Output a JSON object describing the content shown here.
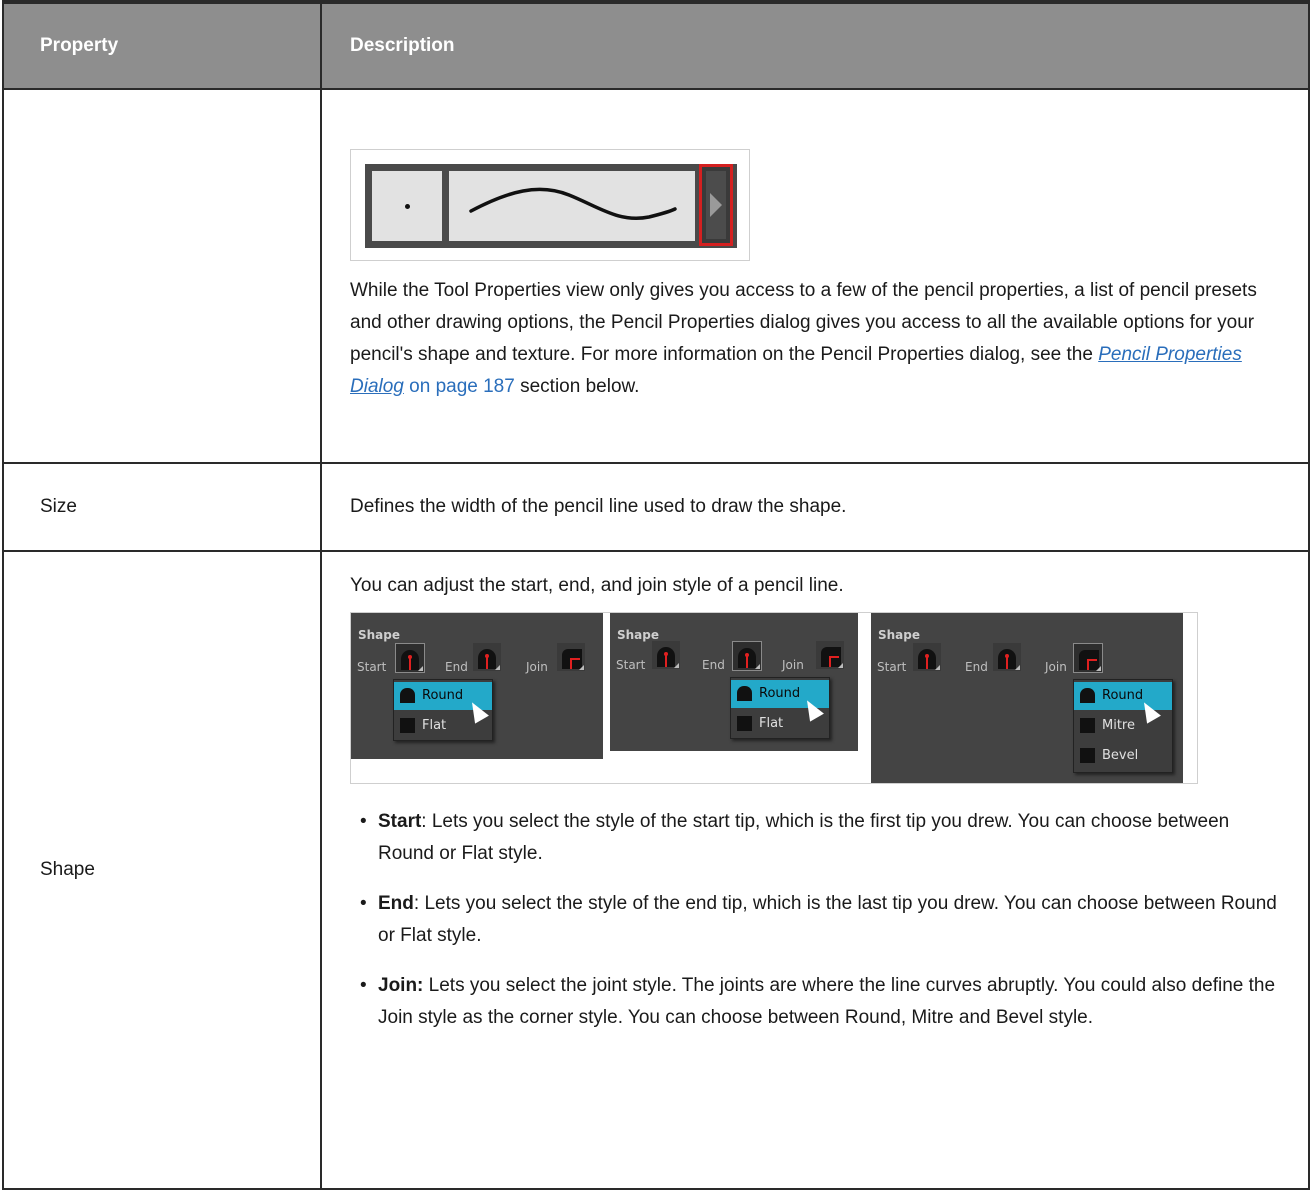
{
  "header": {
    "col1": "Property",
    "col2": "Description"
  },
  "row1": {
    "property": "",
    "para_before": "While the Tool Properties view only gives you access to a few of the pencil properties, a list of pencil presets and other drawing options, the Pencil Properties dialog gives you access to all the available options for your pencil's shape and texture. For more information on the Pencil Properties dialog, see the ",
    "link_text": "Pencil Properties Dialog",
    "page_ref": " on page 187",
    "para_after": " section below."
  },
  "row2": {
    "property": "Size",
    "description": "Defines the width of the pencil line used to draw the shape."
  },
  "row3": {
    "property": "Shape",
    "intro": "You can adjust the start, end, and join style of a pencil line.",
    "panels": [
      {
        "title": "Shape",
        "start": "Start",
        "end": "End",
        "join": "Join",
        "menu": [
          "Round",
          "Flat"
        ]
      },
      {
        "title": "Shape",
        "start": "Start",
        "end": "End",
        "join": "Join",
        "menu": [
          "Round",
          "Flat"
        ]
      },
      {
        "title": "Shape",
        "start": "Start",
        "end": "End",
        "join": "Join",
        "menu": [
          "Round",
          "Mitre",
          "Bevel"
        ]
      }
    ],
    "bullets": [
      {
        "term": "Start",
        "text": ": Lets you select the style of the start tip, which is the first tip you drew. You can choose between Round or Flat style."
      },
      {
        "term": "End",
        "text": ": Lets you select the style of the end tip, which is the last tip you drew. You can choose between Round or Flat style."
      },
      {
        "term": "Join:",
        "text": " Lets you select the joint style. The joints are where the line curves abruptly. You could also define the Join style as the corner style. You can choose between Round, Mitre and Bevel style."
      }
    ]
  },
  "colors": {
    "header_bg": "#8e8e8e",
    "link": "#2a6ebb",
    "highlight": "#23a9c9",
    "red_outline": "#d42020"
  }
}
